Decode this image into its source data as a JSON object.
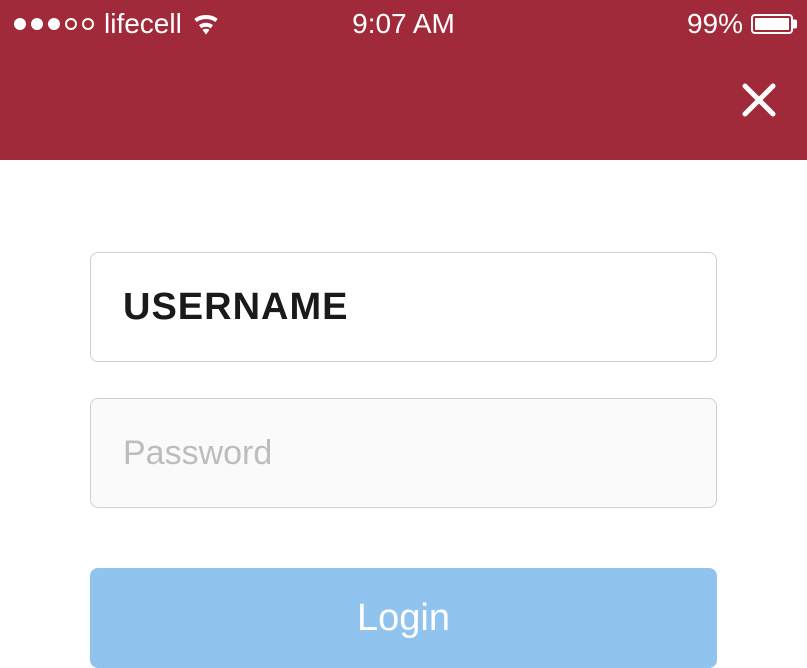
{
  "statusBar": {
    "carrier": "lifecell",
    "time": "9:07 AM",
    "batteryPercent": "99%"
  },
  "form": {
    "usernameValue": "USERNAME",
    "passwordPlaceholder": "Password",
    "loginLabel": "Login"
  }
}
